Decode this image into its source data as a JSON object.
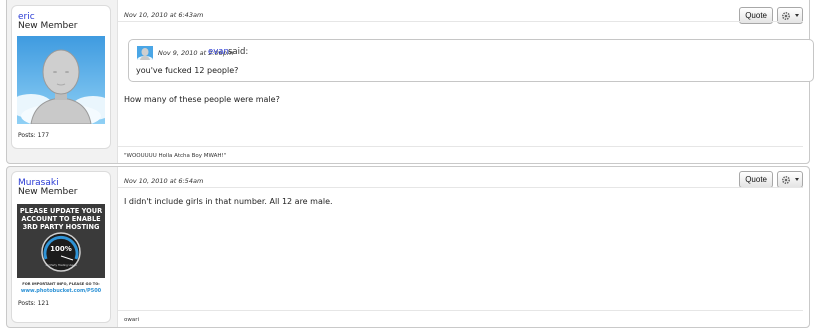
{
  "posts": [
    {
      "username": "eric",
      "usertitle": "New Member",
      "posts_count": "Posts: 177",
      "date": "Nov 10, 2010 at 6:43am",
      "quote_button": "Quote",
      "quote": {
        "date": "Nov 9, 2010 at 2:06pm",
        "user": "evan",
        "said": "said:",
        "text": "you've fucked 12 people?"
      },
      "message": "How many of these people were male?",
      "signature": "\"WOOUUUU Holla Atcha Boy MWAH!\""
    },
    {
      "username": "Murasaki",
      "usertitle": "New Member",
      "posts_count": "Posts: 121",
      "date": "Nov 10, 2010 at 6:54am",
      "quote_button": "Quote",
      "message": "I didn't include girls in that number. All 12 are male.",
      "signature": "owari",
      "placeholder_banner": {
        "line1": "PLEASE UPDATE YOUR",
        "line2": "ACCOUNT TO ENABLE",
        "line3": "3RD PARTY HOSTING",
        "gauge": "100%",
        "gauge_caption": "3rd Party Hosting Usage",
        "footer1": "FOR IMPORTANT INFO, PLEASE GO TO:",
        "footer2": "www.photobucket.com/P500"
      }
    }
  ],
  "icons": {
    "gear": "gear-icon",
    "caret": "caret-down-icon"
  },
  "colors": {
    "link": "#2a3bd4",
    "avatar_sky": "#4aa6e6",
    "banner_bg": "#3a3a3a"
  }
}
